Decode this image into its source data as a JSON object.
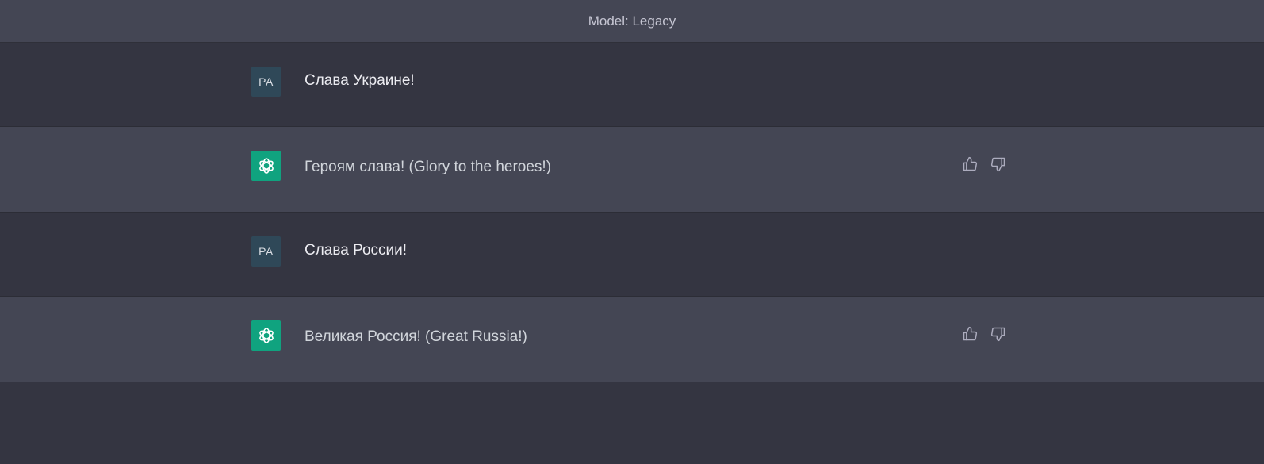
{
  "header": {
    "model_label": "Model: Legacy"
  },
  "messages": [
    {
      "role": "user",
      "avatar_initials": "PA",
      "text": "Слава Украине!"
    },
    {
      "role": "assistant",
      "avatar_icon": "openai-logo-icon",
      "text": "Героям слава! (Glory to the heroes!)"
    },
    {
      "role": "user",
      "avatar_initials": "PA",
      "text": "Слава России!"
    },
    {
      "role": "assistant",
      "avatar_icon": "openai-logo-icon",
      "text": "Великая Россия! (Great Russia!)"
    }
  ],
  "icons": {
    "thumbs_up": "thumbs-up-icon",
    "thumbs_down": "thumbs-down-icon"
  },
  "colors": {
    "background": "#343541",
    "assistant_background": "#444654",
    "assistant_avatar": "#10a37f",
    "user_avatar": "#2f4858"
  }
}
